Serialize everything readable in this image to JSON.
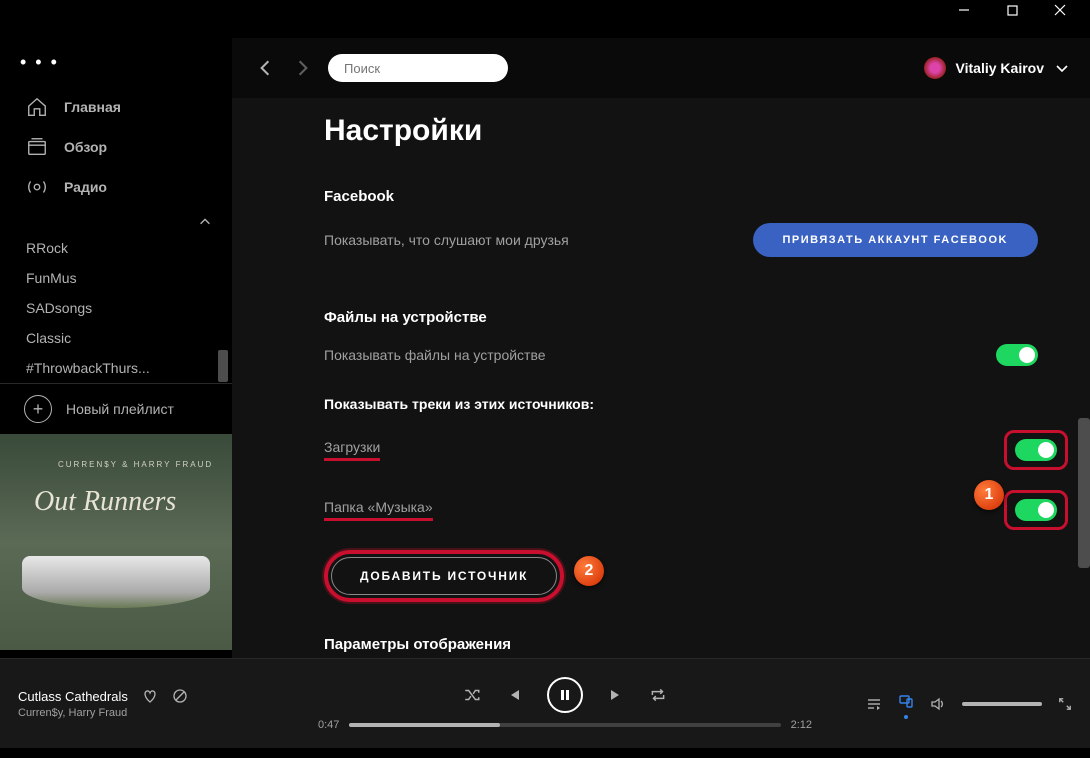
{
  "window": {
    "minimize": "—",
    "maximize": "▢",
    "close": "✕"
  },
  "topbar": {
    "search_placeholder": "Поиск",
    "user_name": "Vitaliy Kairov"
  },
  "sidebar": {
    "dots": "• • •",
    "nav": [
      {
        "label": "Главная",
        "icon": "home-icon"
      },
      {
        "label": "Обзор",
        "icon": "browse-icon"
      },
      {
        "label": "Радио",
        "icon": "radio-icon"
      }
    ],
    "playlists": [
      "RRock",
      "FunMus",
      "SADsongs",
      "Classic",
      "#ThrowbackThurs..."
    ],
    "new_playlist": "Новый плейлист",
    "album_line1": "CURREN$Y & HARRY FRAUD",
    "album_line2": "Out Runners"
  },
  "settings": {
    "title": "Настройки",
    "facebook": {
      "head": "Facebook",
      "desc": "Показывать, что слушают мои друзья",
      "button": "ПРИВЯЗАТЬ АККАУНТ FACEBOOK"
    },
    "local_files": {
      "head": "Файлы на устройстве",
      "desc": "Показывать файлы на устройстве",
      "subhead": "Показывать треки из этих источников:",
      "sources": [
        {
          "label": "Загрузки",
          "on": true
        },
        {
          "label": "Папка «Музыка»",
          "on": true
        }
      ],
      "add_button": "ДОБАВИТЬ ИСТОЧНИК"
    },
    "display": {
      "head": "Параметры отображения"
    }
  },
  "callouts": {
    "one": "1",
    "two": "2"
  },
  "player": {
    "track": "Cutlass Cathedrals",
    "artist": "Curren$y, Harry Fraud",
    "elapsed": "0:47",
    "duration": "2:12"
  }
}
